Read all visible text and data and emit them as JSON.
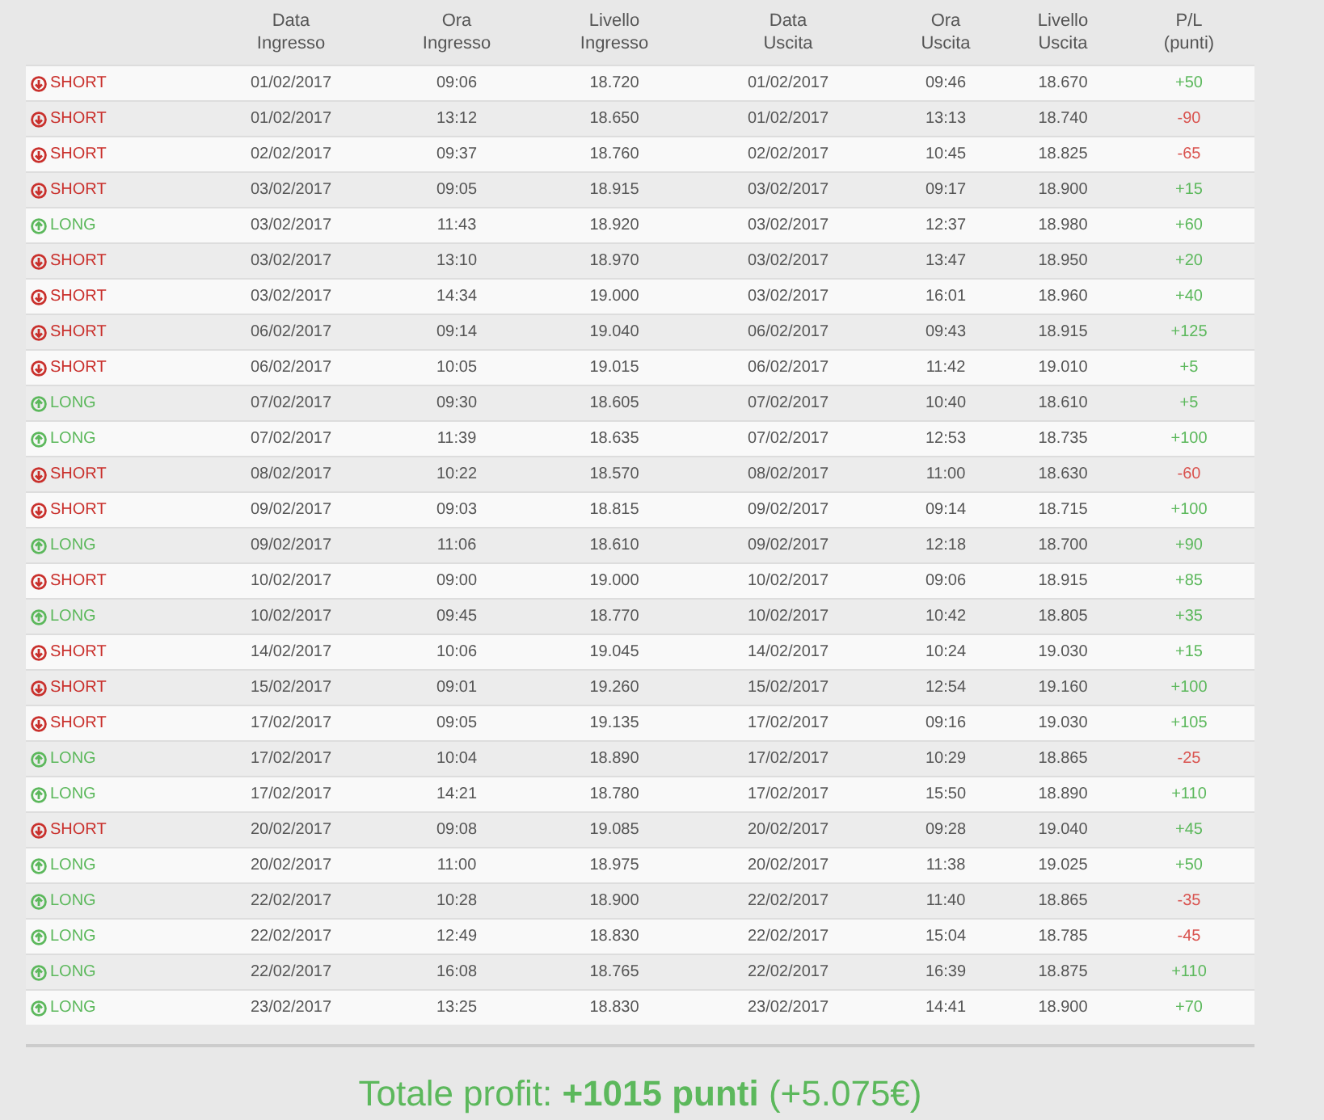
{
  "table": {
    "columns": [
      "Data\nIngresso",
      "Ora\nIngresso",
      "Livello\nIngresso",
      "Data\nUscita",
      "Ora\nUscita",
      "Livello\nUscita",
      "P/L\n(punti)"
    ],
    "rows": [
      {
        "kind": "short",
        "type": "SHORT",
        "cells": [
          "01/02/2017",
          "09:06",
          "18.720",
          "01/02/2017",
          "09:46",
          "18.670"
        ],
        "pl": {
          "text": "+50",
          "color": "#5cb85c"
        }
      },
      {
        "kind": "short",
        "type": "SHORT",
        "cells": [
          "01/02/2017",
          "13:12",
          "18.650",
          "01/02/2017",
          "13:13",
          "18.740"
        ],
        "pl": {
          "text": "-90",
          "color": "#d9534f"
        }
      },
      {
        "kind": "short",
        "type": "SHORT",
        "cells": [
          "02/02/2017",
          "09:37",
          "18.760",
          "02/02/2017",
          "10:45",
          "18.825"
        ],
        "pl": {
          "text": "-65",
          "color": "#d9534f"
        }
      },
      {
        "kind": "short",
        "type": "SHORT",
        "cells": [
          "03/02/2017",
          "09:05",
          "18.915",
          "03/02/2017",
          "09:17",
          "18.900"
        ],
        "pl": {
          "text": "+15",
          "color": "#5cb85c"
        }
      },
      {
        "kind": "long",
        "type": "LONG",
        "cells": [
          "03/02/2017",
          "11:43",
          "18.920",
          "03/02/2017",
          "12:37",
          "18.980"
        ],
        "pl": {
          "text": "+60",
          "color": "#5cb85c"
        }
      },
      {
        "kind": "short",
        "type": "SHORT",
        "cells": [
          "03/02/2017",
          "13:10",
          "18.970",
          "03/02/2017",
          "13:47",
          "18.950"
        ],
        "pl": {
          "text": "+20",
          "color": "#5cb85c"
        }
      },
      {
        "kind": "short",
        "type": "SHORT",
        "cells": [
          "03/02/2017",
          "14:34",
          "19.000",
          "03/02/2017",
          "16:01",
          "18.960"
        ],
        "pl": {
          "text": "+40",
          "color": "#5cb85c"
        }
      },
      {
        "kind": "short",
        "type": "SHORT",
        "cells": [
          "06/02/2017",
          "09:14",
          "19.040",
          "06/02/2017",
          "09:43",
          "18.915"
        ],
        "pl": {
          "text": "+125",
          "color": "#5cb85c"
        }
      },
      {
        "kind": "short",
        "type": "SHORT",
        "cells": [
          "06/02/2017",
          "10:05",
          "19.015",
          "06/02/2017",
          "11:42",
          "19.010"
        ],
        "pl": {
          "text": "+5",
          "color": "#5cb85c"
        }
      },
      {
        "kind": "long",
        "type": "LONG",
        "cells": [
          "07/02/2017",
          "09:30",
          "18.605",
          "07/02/2017",
          "10:40",
          "18.610"
        ],
        "pl": {
          "text": "+5",
          "color": "#5cb85c"
        }
      },
      {
        "kind": "long",
        "type": "LONG",
        "cells": [
          "07/02/2017",
          "11:39",
          "18.635",
          "07/02/2017",
          "12:53",
          "18.735"
        ],
        "pl": {
          "text": "+100",
          "color": "#5cb85c"
        }
      },
      {
        "kind": "short",
        "type": "SHORT",
        "cells": [
          "08/02/2017",
          "10:22",
          "18.570",
          "08/02/2017",
          "11:00",
          "18.630"
        ],
        "pl": {
          "text": "-60",
          "color": "#d9534f"
        }
      },
      {
        "kind": "short",
        "type": "SHORT",
        "cells": [
          "09/02/2017",
          "09:03",
          "18.815",
          "09/02/2017",
          "09:14",
          "18.715"
        ],
        "pl": {
          "text": "+100",
          "color": "#5cb85c"
        }
      },
      {
        "kind": "long",
        "type": "LONG",
        "cells": [
          "09/02/2017",
          "11:06",
          "18.610",
          "09/02/2017",
          "12:18",
          "18.700"
        ],
        "pl": {
          "text": "+90",
          "color": "#5cb85c"
        }
      },
      {
        "kind": "short",
        "type": "SHORT",
        "cells": [
          "10/02/2017",
          "09:00",
          "19.000",
          "10/02/2017",
          "09:06",
          "18.915"
        ],
        "pl": {
          "text": "+85",
          "color": "#5cb85c"
        }
      },
      {
        "kind": "long",
        "type": "LONG",
        "cells": [
          "10/02/2017",
          "09:45",
          "18.770",
          "10/02/2017",
          "10:42",
          "18.805"
        ],
        "pl": {
          "text": "+35",
          "color": "#5cb85c"
        }
      },
      {
        "kind": "short",
        "type": "SHORT",
        "cells": [
          "14/02/2017",
          "10:06",
          "19.045",
          "14/02/2017",
          "10:24",
          "19.030"
        ],
        "pl": {
          "text": "+15",
          "color": "#5cb85c"
        }
      },
      {
        "kind": "short",
        "type": "SHORT",
        "cells": [
          "15/02/2017",
          "09:01",
          "19.260",
          "15/02/2017",
          "12:54",
          "19.160"
        ],
        "pl": {
          "text": "+100",
          "color": "#5cb85c"
        }
      },
      {
        "kind": "short",
        "type": "SHORT",
        "cells": [
          "17/02/2017",
          "09:05",
          "19.135",
          "17/02/2017",
          "09:16",
          "19.030"
        ],
        "pl": {
          "text": "+105",
          "color": "#5cb85c"
        }
      },
      {
        "kind": "long",
        "type": "LONG",
        "cells": [
          "17/02/2017",
          "10:04",
          "18.890",
          "17/02/2017",
          "10:29",
          "18.865"
        ],
        "pl": {
          "text": "-25",
          "color": "#d9534f"
        }
      },
      {
        "kind": "long",
        "type": "LONG",
        "cells": [
          "17/02/2017",
          "14:21",
          "18.780",
          "17/02/2017",
          "15:50",
          "18.890"
        ],
        "pl": {
          "text": "+110",
          "color": "#5cb85c"
        }
      },
      {
        "kind": "short",
        "type": "SHORT",
        "cells": [
          "20/02/2017",
          "09:08",
          "19.085",
          "20/02/2017",
          "09:28",
          "19.040"
        ],
        "pl": {
          "text": "+45",
          "color": "#5cb85c"
        }
      },
      {
        "kind": "long",
        "type": "LONG",
        "cells": [
          "20/02/2017",
          "11:00",
          "18.975",
          "20/02/2017",
          "11:38",
          "19.025"
        ],
        "pl": {
          "text": "+50",
          "color": "#5cb85c"
        }
      },
      {
        "kind": "long",
        "type": "LONG",
        "cells": [
          "22/02/2017",
          "10:28",
          "18.900",
          "22/02/2017",
          "11:40",
          "18.865"
        ],
        "pl": {
          "text": "-35",
          "color": "#d9534f"
        }
      },
      {
        "kind": "long",
        "type": "LONG",
        "cells": [
          "22/02/2017",
          "12:49",
          "18.830",
          "22/02/2017",
          "15:04",
          "18.785"
        ],
        "pl": {
          "text": "-45",
          "color": "#d9534f"
        }
      },
      {
        "kind": "long",
        "type": "LONG",
        "cells": [
          "22/02/2017",
          "16:08",
          "18.765",
          "22/02/2017",
          "16:39",
          "18.875"
        ],
        "pl": {
          "text": "+110",
          "color": "#5cb85c"
        }
      },
      {
        "kind": "long",
        "type": "LONG",
        "cells": [
          "23/02/2017",
          "13:25",
          "18.830",
          "23/02/2017",
          "14:41",
          "18.900"
        ],
        "pl": {
          "text": "+70",
          "color": "#5cb85c"
        }
      }
    ]
  },
  "total": "Totale profit: **+1015 punti** (+5.075€)"
}
